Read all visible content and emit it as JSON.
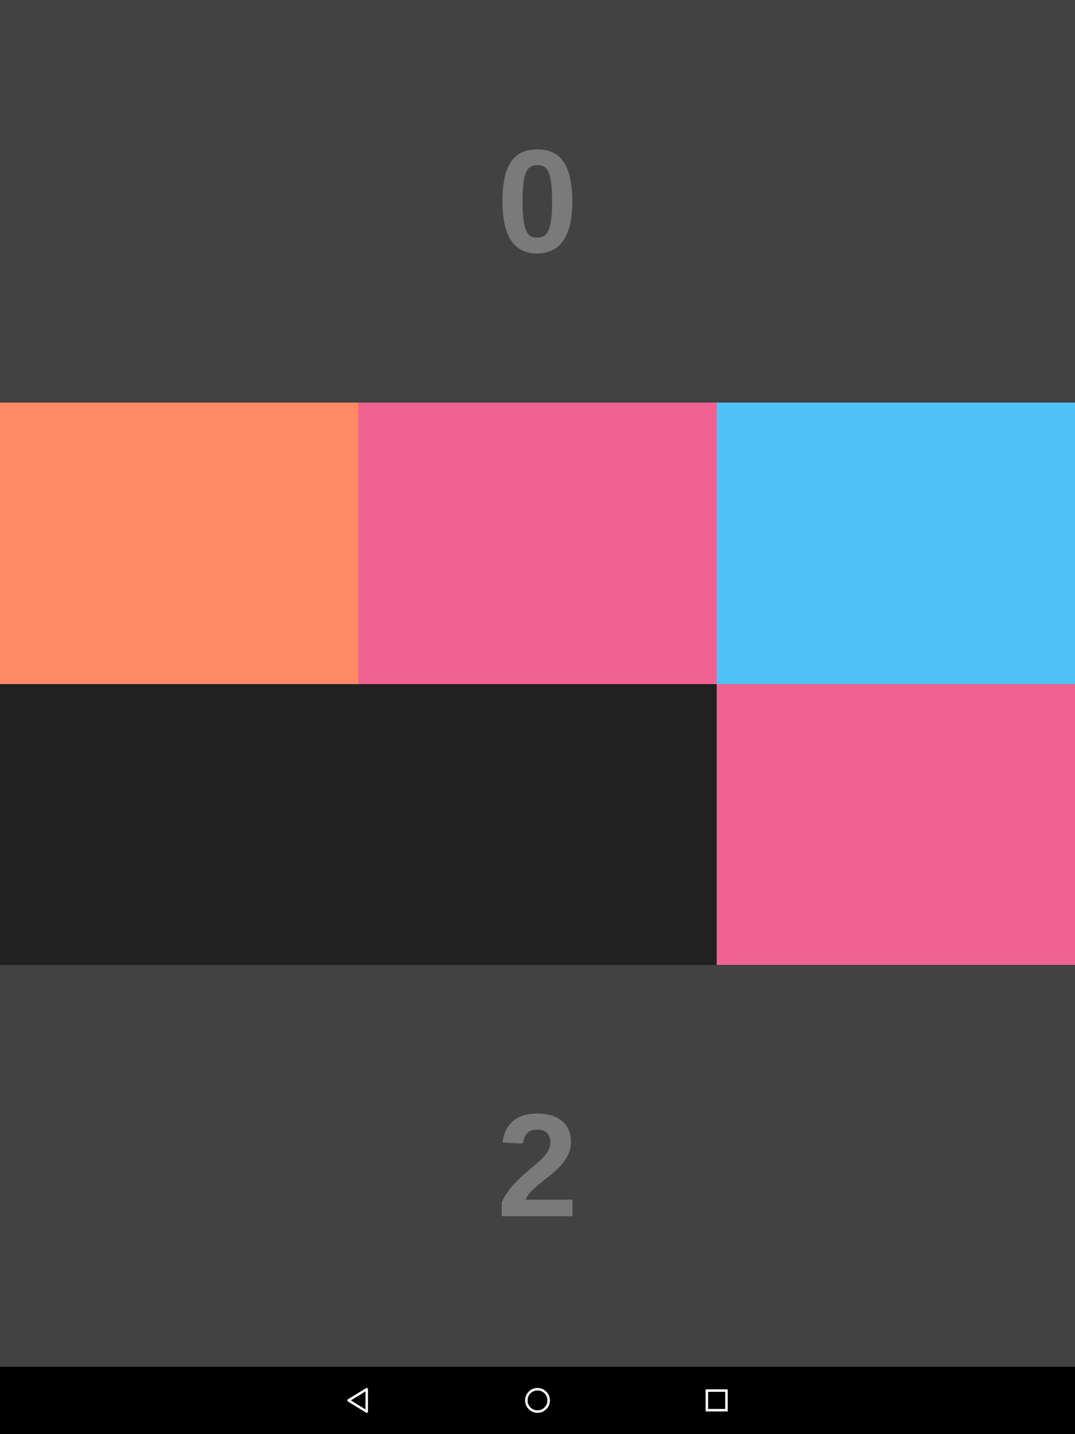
{
  "scores": {
    "top": "0",
    "bottom": "2"
  },
  "grid": {
    "tiles": [
      {
        "color": "#FF8A65"
      },
      {
        "color": "#F06292"
      },
      {
        "color": "#4FC3F7"
      },
      {
        "color": "#212121"
      },
      {
        "color": "#212121"
      },
      {
        "color": "#F06292"
      }
    ]
  },
  "colors": {
    "panel_background": "#424242",
    "score_text": "#7A7A7A",
    "nav_background": "#000000"
  },
  "nav": {
    "icons": [
      "back-icon",
      "home-icon",
      "recents-icon"
    ]
  }
}
